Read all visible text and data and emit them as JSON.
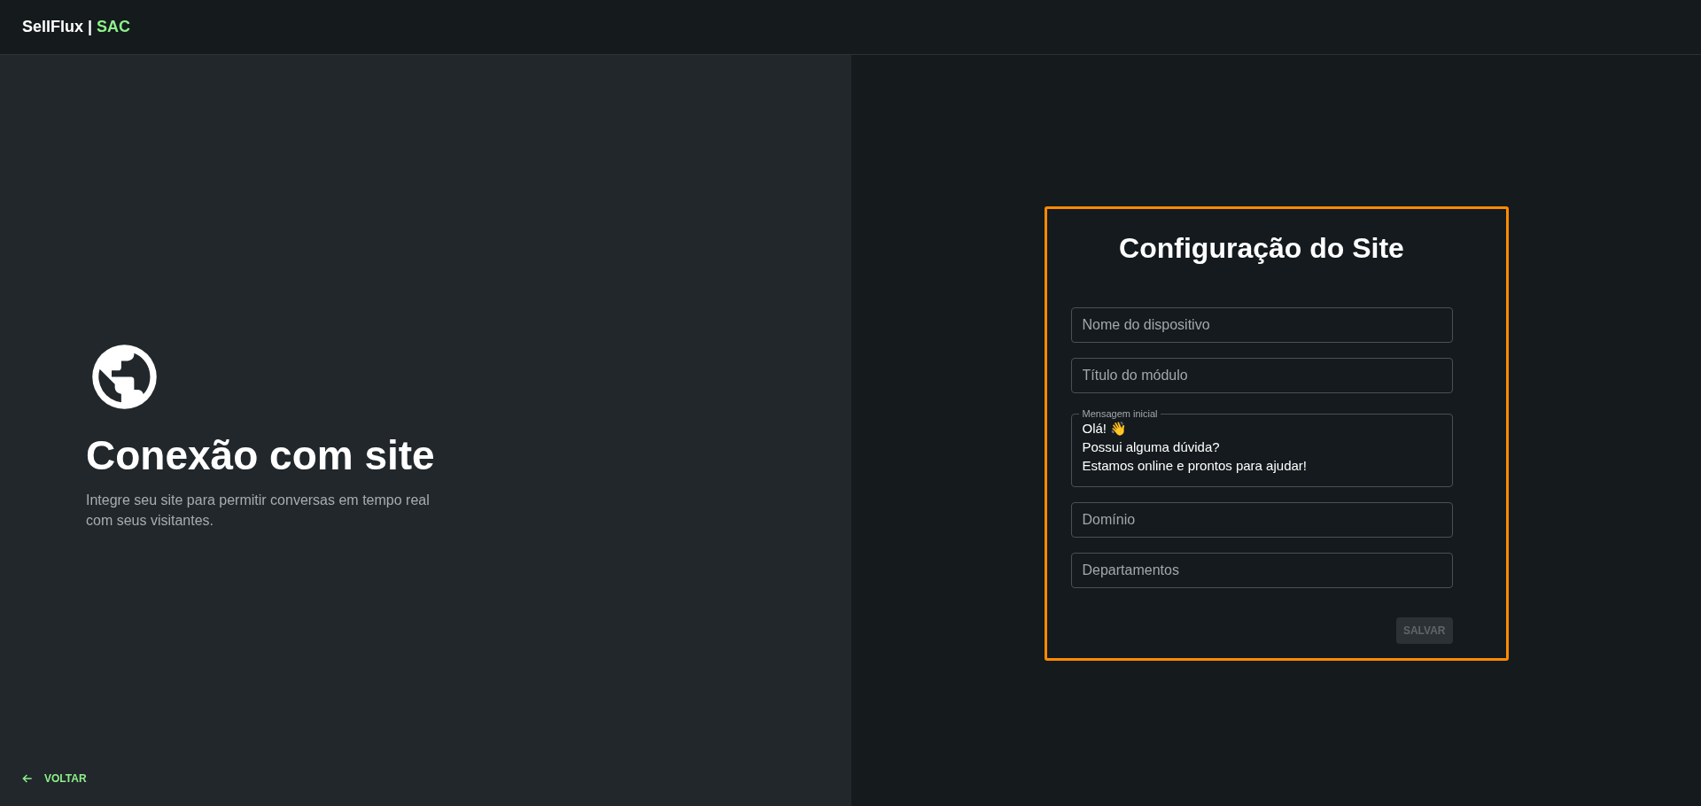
{
  "header": {
    "brand": "SellFlux",
    "separator": "|",
    "product": "SAC"
  },
  "intro": {
    "title": "Conexão com site",
    "description": "Integre seu site para permitir conversas em tempo real com seus visitantes."
  },
  "back_link": {
    "label": "VOLTAR"
  },
  "form": {
    "title": "Configuração do Site",
    "fields": [
      {
        "kind": "input",
        "placeholder": "Nome do dispositivo"
      },
      {
        "kind": "input",
        "placeholder": "Título do módulo"
      },
      {
        "kind": "textarea",
        "label": "Mensagem inicial",
        "value": "Olá! 👋\nPossui alguma dúvida?\nEstamos online e prontos para ajudar!"
      },
      {
        "kind": "input",
        "placeholder": "Domínio"
      },
      {
        "kind": "input",
        "placeholder": "Departamentos"
      }
    ],
    "save_button": {
      "label": "SALVAR",
      "disabled": true
    }
  }
}
